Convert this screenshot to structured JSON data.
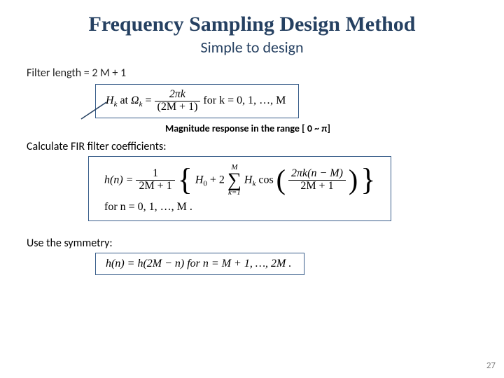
{
  "title": "Frequency Sampling Design Method",
  "subtitle": "Simple to design",
  "filter_length": "Filter length = 2 M + 1",
  "eq1": {
    "Hk": "H",
    "k": "k",
    "at": " at ",
    "Omega": "Ω",
    "eq": " = ",
    "num": "2πk",
    "den": "(2M + 1)",
    "for": "  for k = 0, 1, …, M"
  },
  "magnitude_note": "Magnitude response in the range [ 0 ~ π]",
  "calc_label": "Calculate FIR filter coefficients:",
  "eq2": {
    "lhs": "h(n) = ",
    "frac1_num": "1",
    "frac1_den": "2M + 1",
    "H0": "H",
    "zero": "0",
    "plus2": " + 2",
    "sum_top": "M",
    "sum_bot": "k=1",
    "Hk": "H",
    "k": "k",
    "cos": " cos",
    "arg_num": "2πk(n − M)",
    "arg_den": "2M + 1",
    "for_line": "for n = 0, 1, …, M ."
  },
  "symmetry_label": "Use the symmetry:",
  "eq3": "h(n) = h(2M − n)  for  n = M + 1, …, 2M .",
  "page": "27"
}
